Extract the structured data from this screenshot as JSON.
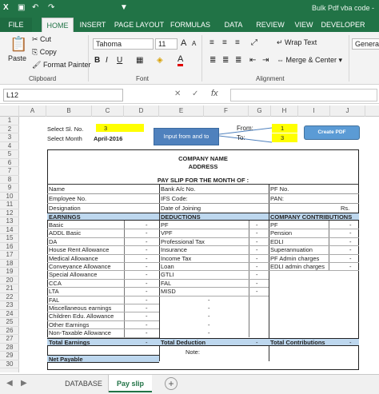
{
  "title_bar": {
    "title": "Bulk Pdf vba code -"
  },
  "ribbon_tabs": [
    "FILE",
    "HOME",
    "INSERT",
    "PAGE LAYOUT",
    "FORMULAS",
    "DATA",
    "REVIEW",
    "VIEW",
    "DEVELOPER"
  ],
  "clipboard": {
    "cut": "Cut",
    "copy": "Copy",
    "paste": "Paste",
    "format_painter": "Format Painter",
    "group": "Clipboard"
  },
  "font": {
    "name": "Tahoma",
    "size": "11",
    "grow": "A",
    "shrink": "A",
    "bold": "B",
    "italic": "I",
    "underline": "U",
    "font_color": "A",
    "group": "Font"
  },
  "alignment": {
    "wrap": "Wrap Text",
    "merge": "Merge & Center",
    "group": "Alignment"
  },
  "number": {
    "format": "General"
  },
  "formula_bar": {
    "name_box": "L12",
    "fx": "fx",
    "cancel": "✕",
    "enter": "✓"
  },
  "columns": [
    "A",
    "B",
    "C",
    "D",
    "E",
    "F",
    "G",
    "H",
    "I",
    "J"
  ],
  "rows": [
    "1",
    "2",
    "3",
    "4",
    "5",
    "6",
    "7",
    "8",
    "9",
    "10",
    "11",
    "12",
    "13",
    "14",
    "15",
    "16",
    "17",
    "18",
    "19",
    "20",
    "21",
    "22",
    "23",
    "24",
    "25",
    "26",
    "27",
    "28",
    "29",
    "30"
  ],
  "sheet": {
    "select_sl_label": "Select Sl. No.",
    "select_sl_value": "3",
    "select_month_label": "Select Month",
    "select_month_value": "April-2016",
    "input_note": "Input from and to",
    "from_label": "From:",
    "from_value": "1",
    "to_label": "To:",
    "to_value": "3",
    "create_pdf": "Create PDF",
    "company_name": "COMPANY NAME",
    "address": "ADDRESS",
    "pay_slip": "PAY SLIP FOR THE MONTH OF :",
    "name": "Name",
    "bank": "Bank A/c No.",
    "pf_no": "PF No.",
    "emp_no": "Employee No.",
    "ifs": "IFS Code:",
    "pan": "PAN:",
    "designation": "Designation",
    "doj": "Date of Joining",
    "rs": "Rs.",
    "earnings_hdr": "EARNINGS",
    "deductions_hdr": "DEDUCTIONS",
    "contrib_hdr": "COMPANY CONTRIBUTIONS",
    "earnings": [
      "Basic",
      "ADDL Basic",
      "DA",
      "House Rent Allowance",
      "Medical Allowance",
      "Conveyance Allowance",
      "Special Allowance",
      "CCA",
      "LTA",
      "FAL",
      "Miscellaneous earnings",
      "Children Edu. Allowance",
      "Other Earnings",
      "Non-Taxable Allowance"
    ],
    "deductions": [
      "PF",
      "VPF",
      "Professional Tax",
      "Insurance",
      "Income Tax",
      "Loan",
      "GTLI",
      "FAL",
      "MISD"
    ],
    "contributions": [
      "PF",
      "Pension",
      "EDLI",
      "Superannuation",
      "PF Admin charges",
      "EDLI admin charges"
    ],
    "dash": "-",
    "total_earnings": "Total Earnings",
    "total_deduction": "Total Deduction",
    "total_contrib": "Total Contributions",
    "note": "Note:",
    "net_payable": "Net Payable"
  },
  "sheet_tabs": {
    "database": "DATABASE",
    "payslip": "Pay slip",
    "add": "+"
  }
}
